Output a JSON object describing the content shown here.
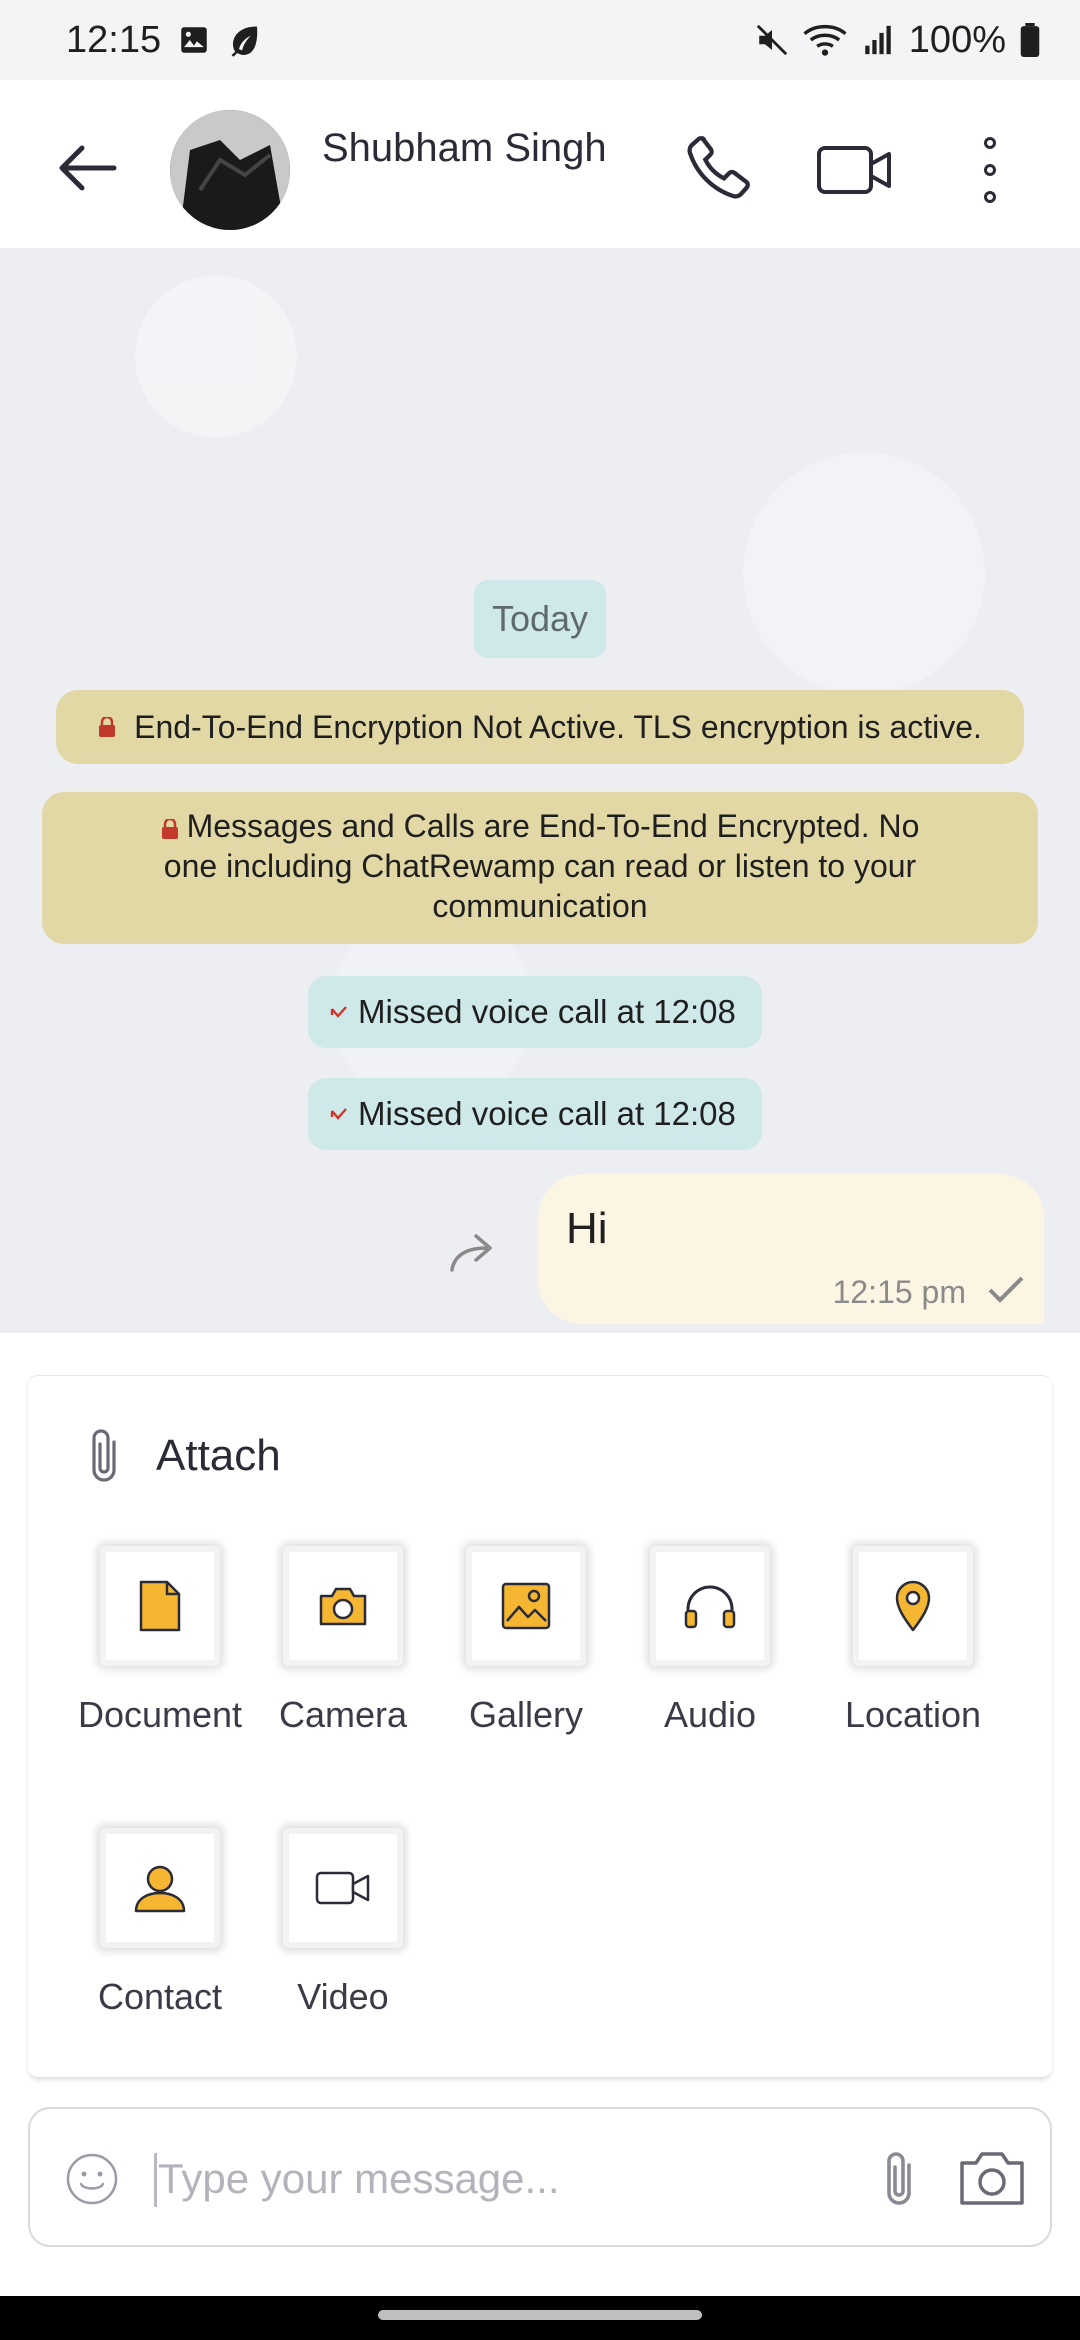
{
  "status_bar": {
    "time": "12:15",
    "battery": "100%"
  },
  "header": {
    "contact_name": "Shubham Singh"
  },
  "chat": {
    "date_chip": "Today",
    "notices": [
      "End-To-End Encryption Not Active. TLS encryption is active.",
      "Messages and Calls are End-To-End Encrypted. No one including ChatRewamp can read or listen to your communication"
    ],
    "missed_calls": [
      "Missed voice call at 12:08",
      "Missed voice call at 12:08"
    ],
    "messages": [
      {
        "text": "Hi",
        "time": "12:15 pm",
        "status": "sent"
      }
    ]
  },
  "attach": {
    "title": "Attach",
    "items": [
      {
        "label": "Document",
        "icon": "document-icon"
      },
      {
        "label": "Camera",
        "icon": "camera-icon"
      },
      {
        "label": "Gallery",
        "icon": "gallery-icon"
      },
      {
        "label": "Audio",
        "icon": "headphones-icon"
      },
      {
        "label": "Location",
        "icon": "location-pin-icon"
      },
      {
        "label": "Contact",
        "icon": "contact-icon"
      },
      {
        "label": "Video",
        "icon": "video-icon"
      }
    ]
  },
  "composer": {
    "placeholder": "Type your message...",
    "value": ""
  },
  "colors": {
    "accent_icon": "#f5b731",
    "notice_bg": "#e2d8a6",
    "chip_bg": "#cfe9ea",
    "outgoing_bubble": "#fdf5e4",
    "chat_bg": "#eceef2"
  }
}
